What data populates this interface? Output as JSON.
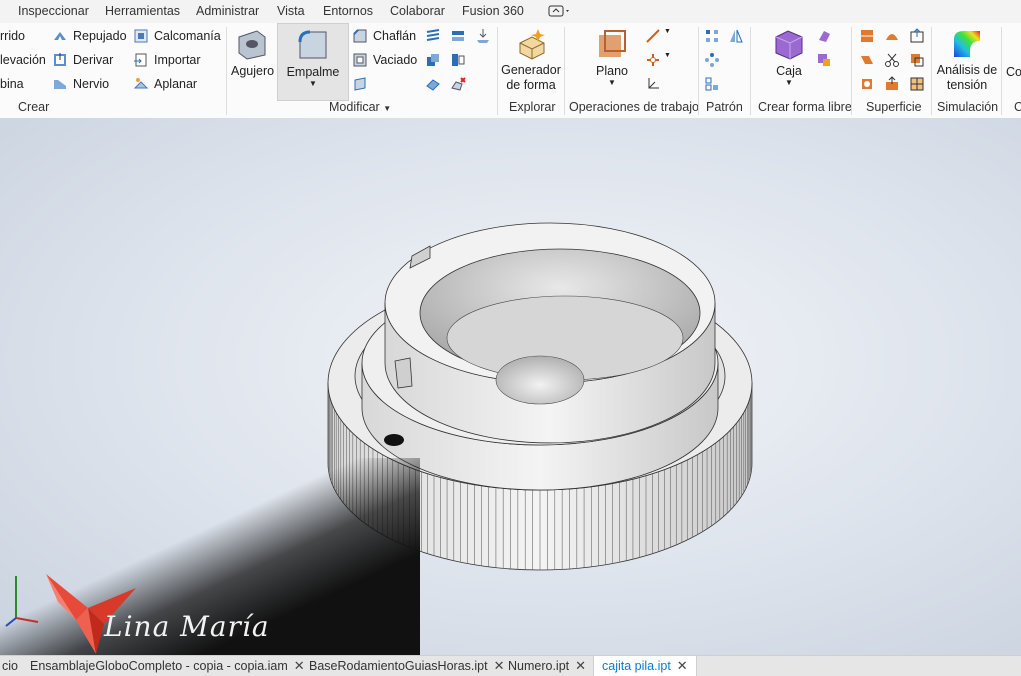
{
  "menu_tabs": [
    "Inspeccionar",
    "Herramientas",
    "Administrar",
    "Vista",
    "Entornos",
    "Colaborar",
    "Fusion 360"
  ],
  "ribbon": {
    "crear": {
      "title": "Crear",
      "col1": [
        "rrido",
        "levación",
        "bina"
      ],
      "col2": [
        "Repujado",
        "Derivar",
        "Nervio"
      ],
      "col3": [
        "Calcomanía",
        "Importar",
        "Aplanar"
      ]
    },
    "modificar": {
      "title": "Modificar",
      "agujero": "Agujero",
      "empalme": "Empalme",
      "chaflan": "Chaflán",
      "vaciado": "Vaciado"
    },
    "explorar": {
      "title": "Explorar",
      "generador": "Generador de forma"
    },
    "operaciones": {
      "title": "Operaciones de trabajo",
      "plano": "Plano"
    },
    "patron": {
      "title": "Patrón"
    },
    "forma_libre": {
      "title": "Crear forma libre",
      "caja": "Caja"
    },
    "superficie": {
      "title": "Superficie"
    },
    "simulacion": {
      "title": "Simulación",
      "analisis": "Análisis de tensión"
    },
    "cut_right": {
      "top": "Co",
      "bottom": "C"
    }
  },
  "viewport": {
    "brand_text": "Lina María",
    "part_color": "#eaeaea"
  },
  "doc_tabs": [
    {
      "label": "cio",
      "closable": false,
      "active": false
    },
    {
      "label": "EnsamblajeGloboCompleto - copia - copia.iam",
      "closable": true,
      "active": false
    },
    {
      "label": "BaseRodamientoGuiasHoras.ipt",
      "closable": true,
      "active": false
    },
    {
      "label": "Numero.ipt",
      "closable": true,
      "active": false
    },
    {
      "label": "cajita pila.ipt",
      "closable": true,
      "active": true
    }
  ]
}
